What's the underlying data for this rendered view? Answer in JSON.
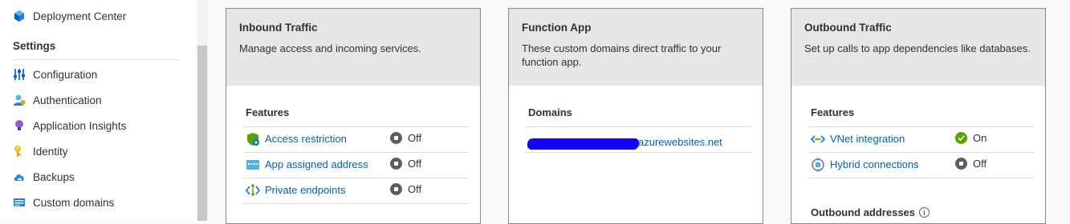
{
  "sidebar": {
    "top_item": {
      "label": "Deployment Center",
      "icon": "deployment-cube-icon"
    },
    "section_label": "Settings",
    "items": [
      {
        "label": "Configuration",
        "icon": "configuration-sliders-icon"
      },
      {
        "label": "Authentication",
        "icon": "authentication-person-icon"
      },
      {
        "label": "Application Insights",
        "icon": "lightbulb-icon"
      },
      {
        "label": "Identity",
        "icon": "identity-key-icon"
      },
      {
        "label": "Backups",
        "icon": "backup-cloud-icon"
      },
      {
        "label": "Custom domains",
        "icon": "domain-globe-icon"
      }
    ]
  },
  "cards": {
    "inbound": {
      "title": "Inbound Traffic",
      "description": "Manage access and incoming services.",
      "features_label": "Features",
      "features": [
        {
          "label": "Access restriction",
          "status": "Off",
          "icon": "shield-icon"
        },
        {
          "label": "App assigned address",
          "status": "Off",
          "icon": "ip-address-icon"
        },
        {
          "label": "Private endpoints",
          "status": "Off",
          "icon": "private-endpoint-icon"
        }
      ]
    },
    "function_app": {
      "title": "Function App",
      "description": "These custom domains direct traffic to your function app.",
      "domains_label": "Domains",
      "domain_suffix": "azurewebsites.net"
    },
    "outbound": {
      "title": "Outbound Traffic",
      "description": "Set up calls to app dependencies like databases.",
      "features_label": "Features",
      "features": [
        {
          "label": "VNet integration",
          "status": "On",
          "icon": "vnet-icon"
        },
        {
          "label": "Hybrid connections",
          "status": "Off",
          "icon": "hybrid-connection-icon"
        }
      ],
      "addresses_label": "Outbound addresses"
    }
  },
  "colors": {
    "link": "#0062ad",
    "on": "#57a300",
    "off": "#605e5c",
    "header_bg": "#e6e6e6"
  }
}
